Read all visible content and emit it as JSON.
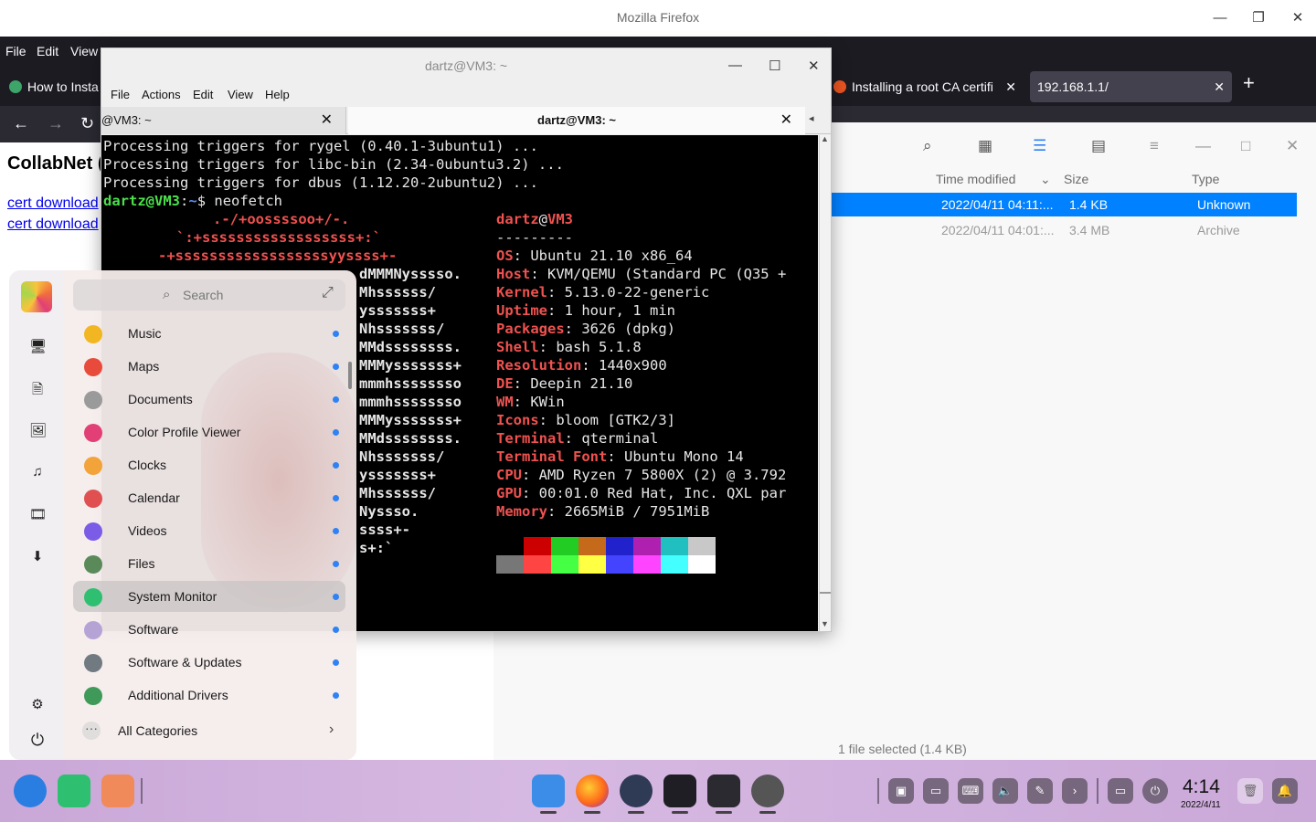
{
  "firefox": {
    "window_title": "Mozilla Firefox",
    "menu": [
      "File",
      "Edit",
      "View"
    ],
    "tabs": [
      {
        "label": "How to Insta",
        "active": false
      },
      {
        "label": "Installing a root CA certifi",
        "active": false
      },
      {
        "label": "192.168.1.1/",
        "active": true
      }
    ],
    "page": {
      "heading": "CollabNet (",
      "links": [
        "cert download",
        "cert download"
      ]
    }
  },
  "file_manager": {
    "columns": [
      "Time modified",
      "Size",
      "Type"
    ],
    "rows": [
      {
        "modified": "2022/04/11 04:11:...",
        "size": "1.4 KB",
        "type": "Unknown",
        "selected": true
      },
      {
        "modified": "2022/04/11 04:01:...",
        "size": "3.4 MB",
        "type": "Archive",
        "selected": false
      }
    ],
    "status": "1 file selected (1.4 KB)"
  },
  "terminal": {
    "window_title": "dartz@VM3: ~",
    "menu": [
      "File",
      "Actions",
      "Edit",
      "View",
      "Help"
    ],
    "tabs": [
      "@VM3: ~",
      "dartz@VM3: ~"
    ],
    "output": [
      "Processing triggers for rygel (0.40.1-3ubuntu1) ...",
      "Processing triggers for libc-bin (2.34-0ubuntu3.2) ...",
      "Processing triggers for dbus (1.12.20-2ubuntu2) ..."
    ],
    "prompt": {
      "user": "dartz@VM3",
      "path": "~",
      "command": "neofetch"
    },
    "logo_lines": [
      ".-/+oossssoo+/-.",
      "`:+ssssssssssssssssss+:`",
      "-+ssssssssssssssssssyyssss+-"
    ],
    "logo_right": [
      "dMMMNysssso.",
      "Mhssssss/",
      "ysssssss+",
      "Nhsssssss/",
      "MMdssssssss.",
      "MMMysssssss+",
      "mmmhssssssso",
      "mmmhssssssso",
      "MMMysssssss+",
      "MMdssssssss.",
      "Nhsssssss/",
      "ysssssss+",
      "Mhssssss/",
      "Nyssso.",
      "ssss+-",
      "s+:`"
    ],
    "info_header": {
      "user": "dartz",
      "host": "VM3",
      "rule": "---------"
    },
    "info": [
      {
        "key": "OS",
        "value": "Ubuntu 21.10 x86_64"
      },
      {
        "key": "Host",
        "value": "KVM/QEMU (Standard PC (Q35 +"
      },
      {
        "key": "Kernel",
        "value": "5.13.0-22-generic"
      },
      {
        "key": "Uptime",
        "value": "1 hour, 1 min"
      },
      {
        "key": "Packages",
        "value": "3626 (dpkg)"
      },
      {
        "key": "Shell",
        "value": "bash 5.1.8"
      },
      {
        "key": "Resolution",
        "value": "1440x900"
      },
      {
        "key": "DE",
        "value": "Deepin 21.10"
      },
      {
        "key": "WM",
        "value": "KWin"
      },
      {
        "key": "Icons",
        "value": "bloom [GTK2/3]"
      },
      {
        "key": "Terminal",
        "value": "qterminal"
      },
      {
        "key": "Terminal Font",
        "value": "Ubuntu Mono 14"
      },
      {
        "key": "CPU",
        "value": "AMD Ryzen 7 5800X (2) @ 3.792"
      },
      {
        "key": "GPU",
        "value": "00:01.0 Red Hat, Inc. QXL par"
      },
      {
        "key": "Memory",
        "value": "2665MiB / 7951MiB"
      }
    ],
    "palette_top": [
      "#000000",
      "#cc0000",
      "#22cc22",
      "#c46a1a",
      "#2222cc",
      "#b020b0",
      "#20c0c0",
      "#c8c8c8"
    ],
    "palette_bottom": [
      "#777777",
      "#ff4444",
      "#44ff44",
      "#ffff44",
      "#4444ff",
      "#ff44ff",
      "#44ffff",
      "#ffffff"
    ]
  },
  "launcher": {
    "search_placeholder": "Search",
    "apps": [
      {
        "label": "Music",
        "color": "#f2b622"
      },
      {
        "label": "Maps",
        "color": "#e84b3c"
      },
      {
        "label": "Documents",
        "color": "#9a9a9a"
      },
      {
        "label": "Color Profile Viewer",
        "color": "#e23f77"
      },
      {
        "label": "Clocks",
        "color": "#f2a33a"
      },
      {
        "label": "Calendar",
        "color": "#e05050"
      },
      {
        "label": "Videos",
        "color": "#7b5ce6"
      },
      {
        "label": "Files",
        "color": "#5a8a5a"
      },
      {
        "label": "System Monitor",
        "color": "#2fbf71"
      },
      {
        "label": "Software",
        "color": "#b6a3d6"
      },
      {
        "label": "Software & Updates",
        "color": "#707a80"
      },
      {
        "label": "Additional Drivers",
        "color": "#3f9a5a"
      }
    ],
    "all_categories": "All Categories"
  },
  "dock": {
    "time": "4:14",
    "date": "2022/4/11"
  }
}
